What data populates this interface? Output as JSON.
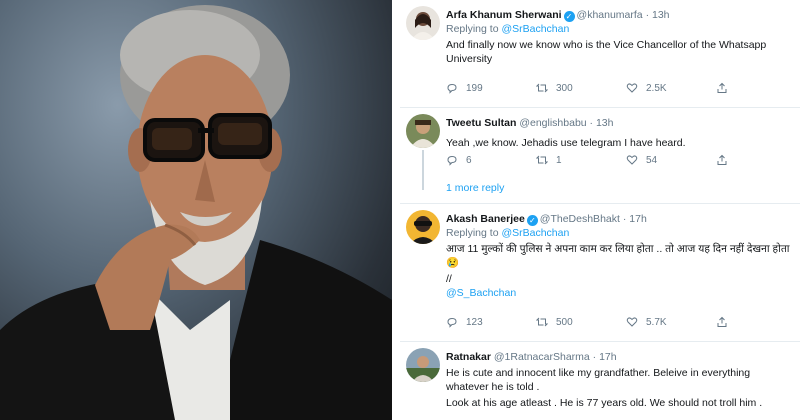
{
  "tweets": [
    {
      "name": "Arfa Khanum Sherwani",
      "verified": true,
      "handle": "@khanumarfa",
      "time": "13h",
      "replying_label": "Replying to",
      "replying_to": "@SrBachchan",
      "text": "And finally now we know who is the Vice Chancellor of the Whatsapp University",
      "replies": "199",
      "retweets": "300",
      "likes": "2.5K"
    },
    {
      "name": "Tweetu Sultan",
      "verified": false,
      "handle": "@englishbabu",
      "time": "13h",
      "text": "Yeah ,we know. Jehadis use telegram I have heard.",
      "replies": "6",
      "retweets": "1",
      "likes": "54",
      "more_replies": "1 more reply"
    },
    {
      "name": "Akash Banerjee",
      "verified": true,
      "handle": "@TheDeshBhakt",
      "time": "17h",
      "replying_label": "Replying to",
      "replying_to": "@SrBachchan",
      "text": "आज 11 मुल्कों की पुलिस ने अपना काम कर लिया होता .. तो आज यह दिन नहीं देखना होता😢",
      "extra1": "//",
      "extra2": "@S_Bachchan",
      "replies": "123",
      "retweets": "500",
      "likes": "5.7K"
    },
    {
      "name": "Ratnakar",
      "verified": false,
      "handle": "@1RatnacarSharma",
      "time": "17h",
      "text": "He is cute and innocent like my grandfather. Beleive in everything whatever he is told .",
      "text2": "Look at his age atleast . He is 77 years old. We should not troll him ."
    }
  ],
  "sep": "·"
}
